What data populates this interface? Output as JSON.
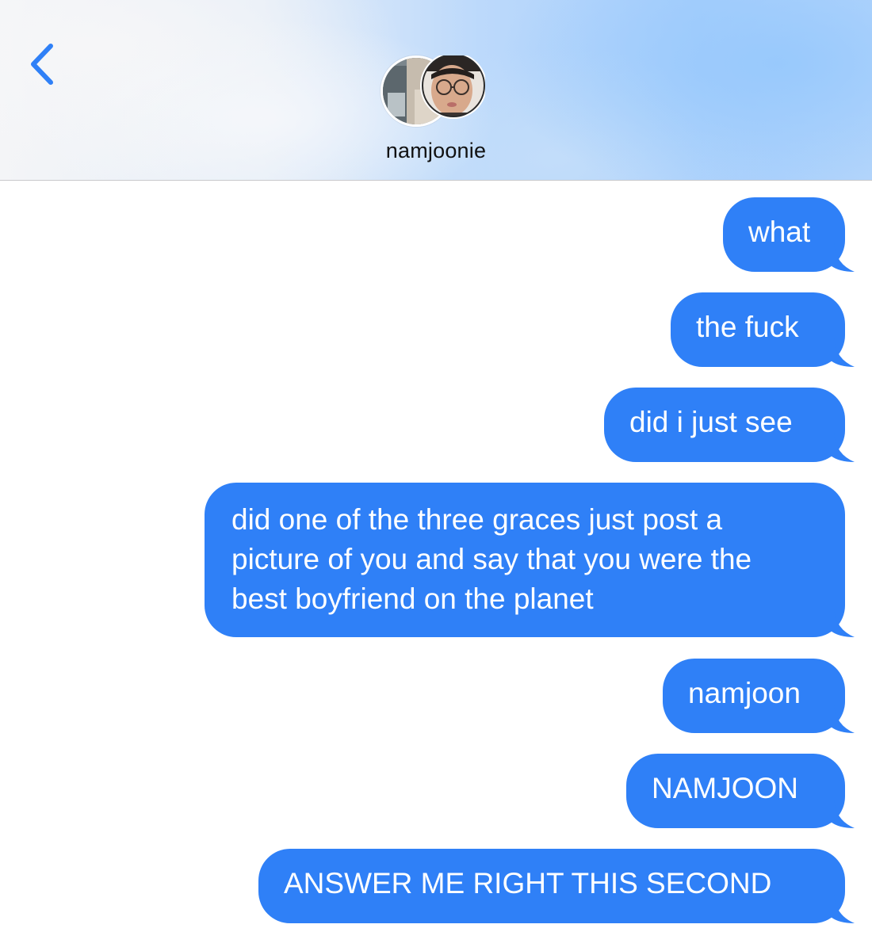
{
  "header": {
    "contact_name": "namjoonie",
    "back_icon": "chevron-left-icon",
    "accent": "#2f80f7"
  },
  "messages": [
    {
      "text": "what",
      "sender": "me"
    },
    {
      "text": "the fuck",
      "sender": "me"
    },
    {
      "text": "did i just see",
      "sender": "me"
    },
    {
      "text": "did one of the three graces just post a picture of you and say that you were the best boyfriend on the planet",
      "sender": "me"
    },
    {
      "text": "namjoon",
      "sender": "me"
    },
    {
      "text": "NAMJOON",
      "sender": "me"
    },
    {
      "text": "ANSWER ME RIGHT THIS SECOND",
      "sender": "me"
    }
  ],
  "colors": {
    "bubble": "#2f80f7",
    "bubble_text": "#ffffff",
    "back_chevron": "#2f80f7"
  }
}
